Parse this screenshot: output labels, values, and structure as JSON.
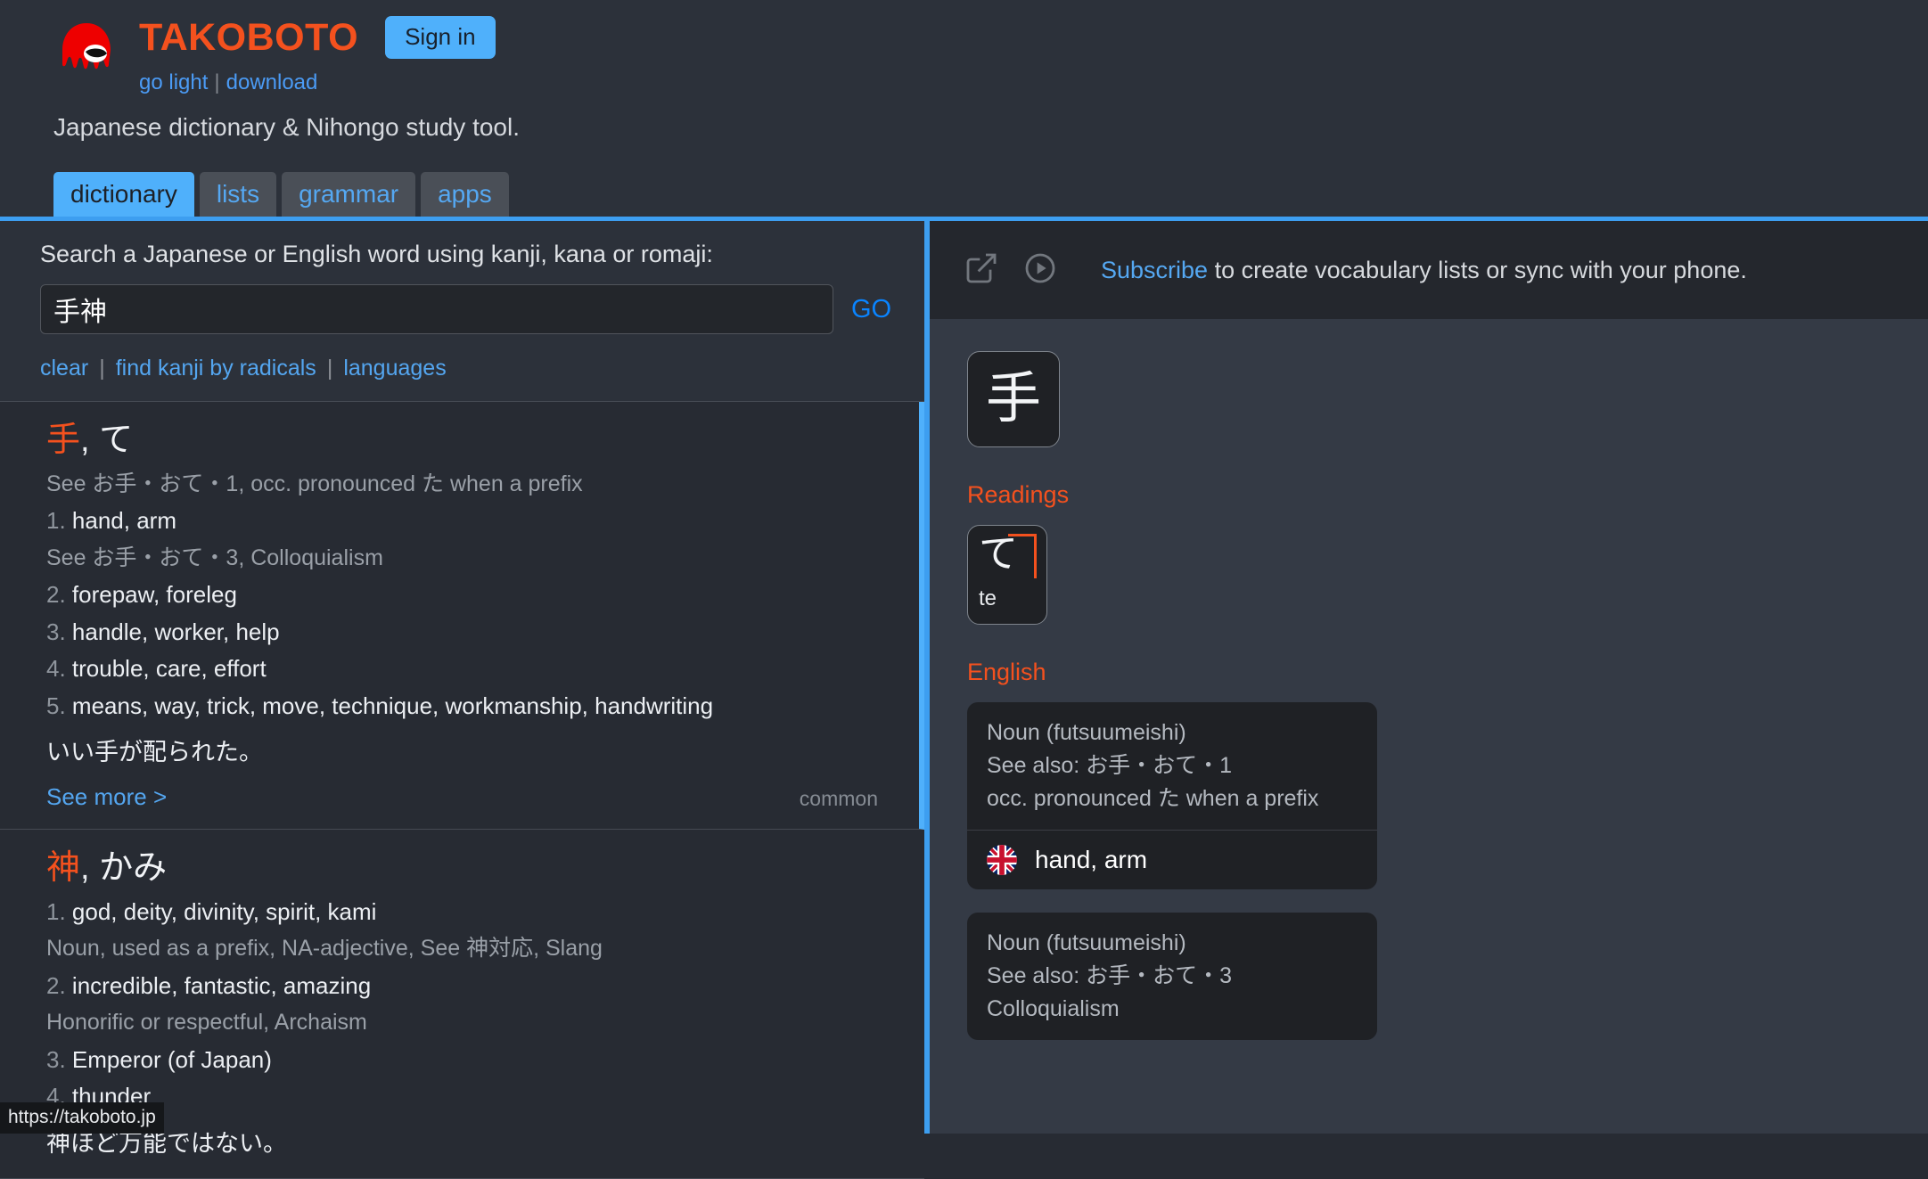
{
  "header": {
    "brand_title": "TAKOBOTO",
    "signin_label": "Sign in",
    "go_light_label": "go light",
    "download_label": "download",
    "separator": "|",
    "tagline": "Japanese dictionary & Nihongo study tool.",
    "logo_icon": "octopus-logo-icon",
    "accent_orange": "#f4511e",
    "accent_blue": "#4fb0fb"
  },
  "tabs": [
    {
      "label": "dictionary",
      "active": true
    },
    {
      "label": "lists",
      "active": false
    },
    {
      "label": "grammar",
      "active": false
    },
    {
      "label": "apps",
      "active": false
    }
  ],
  "search": {
    "label": "Search a Japanese or English word using kanji, kana or romaji:",
    "value": "手神",
    "placeholder": "",
    "go_label": "GO",
    "links": [
      "clear",
      "find kanji by radicals",
      "languages"
    ],
    "link_separator": "|"
  },
  "results": [
    {
      "kanji": "手",
      "comma": ",",
      "kana": "て",
      "selected": true,
      "badge": "common",
      "see_more": "See more >",
      "example": "いい手が配られた。",
      "lines": [
        {
          "type": "note",
          "text": "See お手・おて・1, occ. pronounced た when a prefix"
        },
        {
          "type": "sense",
          "num": "1.",
          "text": "hand, arm"
        },
        {
          "type": "note",
          "text": "See お手・おて・3, Colloquialism"
        },
        {
          "type": "sense",
          "num": "2.",
          "text": "forepaw, foreleg"
        },
        {
          "type": "sense",
          "num": "3.",
          "text": "handle, worker, help"
        },
        {
          "type": "sense",
          "num": "4.",
          "text": "trouble, care, effort"
        },
        {
          "type": "sense",
          "num": "5.",
          "text": "means, way, trick, move, technique, workmanship, handwriting"
        }
      ]
    },
    {
      "kanji": "神",
      "comma": ",",
      "kana": "かみ",
      "selected": false,
      "badge": "",
      "see_more": "",
      "example": "神ほど万能ではない。",
      "lines": [
        {
          "type": "sense",
          "num": "1.",
          "text": "god, deity, divinity, spirit, kami"
        },
        {
          "type": "note",
          "text": "Noun, used as a prefix, NA-adjective, See 神対応, Slang"
        },
        {
          "type": "sense",
          "num": "2.",
          "text": "incredible, fantastic, amazing"
        },
        {
          "type": "note",
          "text": "Honorific or respectful, Archaism"
        },
        {
          "type": "sense",
          "num": "3.",
          "text": "Emperor (of Japan)"
        },
        {
          "type": "sense",
          "num": "4.",
          "text": "thunder"
        }
      ]
    }
  ],
  "right_panel": {
    "subscribe_link": "Subscribe",
    "subscribe_rest": " to create vocabulary lists or sync with your phone.",
    "external_link_icon": "external-link-icon",
    "play_icon": "play-circle-icon",
    "headword_char": "手",
    "readings_heading": "Readings",
    "readings": [
      {
        "kana": "て",
        "romaji": "te"
      }
    ],
    "english_heading": "English",
    "english_cards": [
      {
        "meta": [
          "Noun (futsuumeishi)",
          "See also: お手・おて・1",
          "occ. pronounced た when a prefix"
        ],
        "gloss": "hand, arm",
        "flag": "uk-flag-icon"
      },
      {
        "meta": [
          "Noun (futsuumeishi)",
          "See also: お手・おて・3",
          "Colloquialism"
        ],
        "gloss": "",
        "flag": ""
      }
    ]
  },
  "status_bar": {
    "url": "https://takoboto.jp"
  }
}
